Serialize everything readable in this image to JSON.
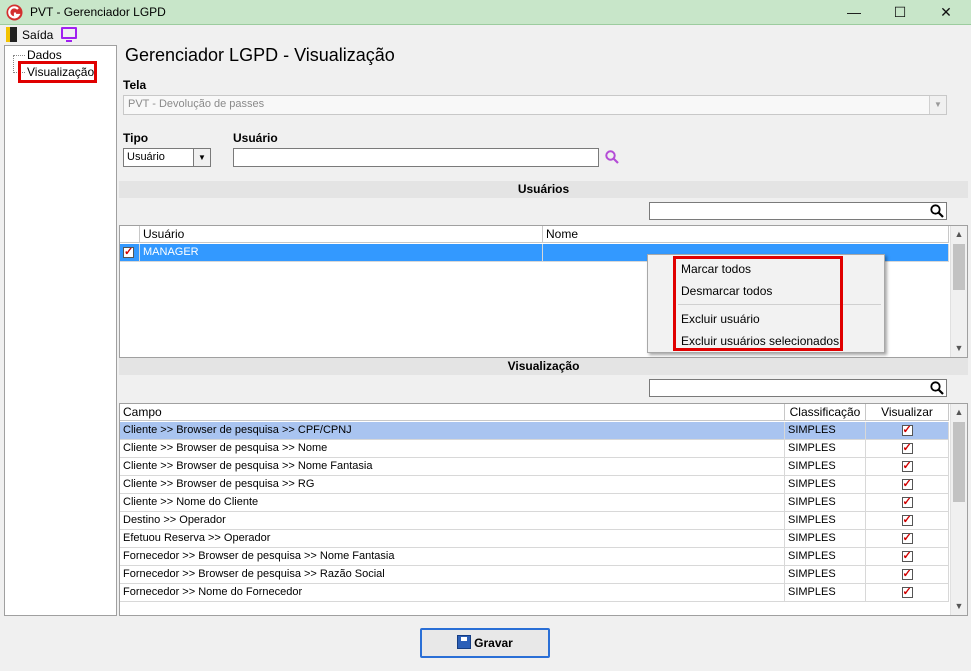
{
  "window": {
    "title": "PVT - Gerenciador LGPD",
    "minimize": "—",
    "maximize": "☐",
    "close": "✕"
  },
  "menubar": {
    "exit_label": "Saída"
  },
  "tree": {
    "items": [
      "Dados",
      "Visualização"
    ]
  },
  "page": {
    "title": "Gerenciador LGPD - Visualização"
  },
  "tela": {
    "label": "Tela",
    "value": "PVT - Devolução de passes"
  },
  "tipo": {
    "label": "Tipo",
    "value": "Usuário"
  },
  "usuario": {
    "label": "Usuário",
    "value": ""
  },
  "users_section": {
    "header": "Usuários",
    "columns": [
      "Usuário",
      "Nome"
    ],
    "rows": [
      {
        "checked": true,
        "usuario": "MANAGER",
        "nome": ""
      }
    ]
  },
  "context_menu": {
    "items": [
      "Marcar todos",
      "Desmarcar todos",
      "Excluir usuário",
      "Excluir usuários selecionados"
    ]
  },
  "view_section": {
    "header": "Visualização",
    "columns": [
      "Campo",
      "Classificação",
      "Visualizar"
    ],
    "rows": [
      {
        "campo": "Cliente >> Browser de pesquisa >> CPF/CPNJ",
        "classificacao": "SIMPLES",
        "visualizar": true
      },
      {
        "campo": "Cliente >> Browser de pesquisa >> Nome",
        "classificacao": "SIMPLES",
        "visualizar": true
      },
      {
        "campo": "Cliente >> Browser de pesquisa >> Nome Fantasia",
        "classificacao": "SIMPLES",
        "visualizar": true
      },
      {
        "campo": "Cliente >> Browser de pesquisa >> RG",
        "classificacao": "SIMPLES",
        "visualizar": true
      },
      {
        "campo": "Cliente >> Nome do Cliente",
        "classificacao": "SIMPLES",
        "visualizar": true
      },
      {
        "campo": "Destino >> Operador",
        "classificacao": "SIMPLES",
        "visualizar": true
      },
      {
        "campo": "Efetuou Reserva >> Operador",
        "classificacao": "SIMPLES",
        "visualizar": true
      },
      {
        "campo": "Fornecedor >> Browser de pesquisa >> Nome Fantasia",
        "classificacao": "SIMPLES",
        "visualizar": true
      },
      {
        "campo": "Fornecedor >> Browser de pesquisa >> Razão Social",
        "classificacao": "SIMPLES",
        "visualizar": true
      },
      {
        "campo": "Fornecedor >> Nome do Fornecedor",
        "classificacao": "SIMPLES",
        "visualizar": true
      }
    ]
  },
  "footer": {
    "save_label": "Gravar"
  },
  "colors": {
    "selection": "#3399ff",
    "selected_row_light": "#a9c4f0",
    "annotation_red": "#e00000",
    "titlebar": "#c8e6c9"
  },
  "icons": [
    "app-logo-icon",
    "exit-door-icon",
    "monitor-icon",
    "search-icon",
    "save-disk-icon"
  ]
}
